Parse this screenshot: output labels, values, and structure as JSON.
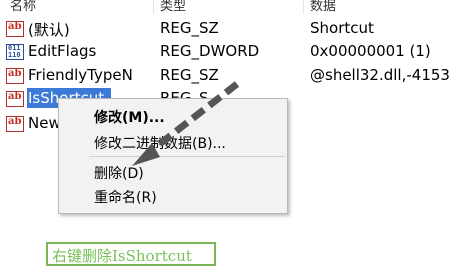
{
  "columns": {
    "name": "名称",
    "type": "类型",
    "data": "数据"
  },
  "rows": [
    {
      "icon": "string-value-icon",
      "name": "(默认)",
      "type": "REG_SZ",
      "data": "Shortcut"
    },
    {
      "icon": "dword-value-icon",
      "name": "EditFlags",
      "type": "REG_DWORD",
      "data": "0x00000001 (1)"
    },
    {
      "icon": "string-value-icon",
      "name": "FriendlyTypeN",
      "type": "REG_SZ",
      "data": "@shell32.dll,-4153"
    },
    {
      "icon": "string-value-icon",
      "name": "IsShortcut",
      "type": "REG_S",
      "data": ""
    },
    {
      "icon": "string-value-icon",
      "name": "New",
      "type": "",
      "data": ""
    }
  ],
  "context_menu": {
    "items": [
      "修改(M)...",
      "修改二进制数据(B)...",
      "删除(D)",
      "重命名(R)"
    ]
  },
  "caption": "右键删除IsShortcut",
  "colors": {
    "selection": "#3b7ad6",
    "caption_border": "#7bb55a",
    "caption_text": "#7ac15a",
    "arrow": "#555555"
  }
}
